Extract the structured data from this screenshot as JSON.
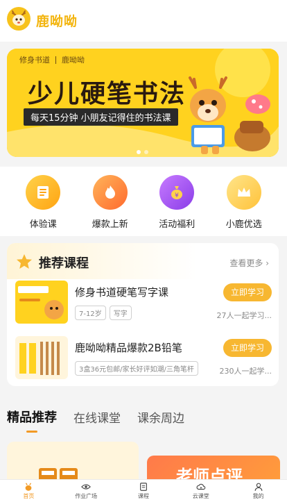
{
  "app": {
    "name": "鹿呦呦"
  },
  "banner": {
    "brand_left": "修身书道",
    "brand_right": "鹿呦呦",
    "title": "少儿硬笔书法",
    "subtitle": "每天15分钟 小朋友记得住的书法课",
    "slides": 2,
    "active_slide": 0
  },
  "quicknav": [
    {
      "label": "体验课",
      "icon": "book-icon",
      "color": "#ffb20f"
    },
    {
      "label": "爆款上新",
      "icon": "flame-icon",
      "color": "#ff8a3d"
    },
    {
      "label": "活动福利",
      "icon": "money-bag-icon",
      "color": "#a84df0"
    },
    {
      "label": "小鹿优选",
      "icon": "crown-icon",
      "color": "#ffc94a"
    }
  ],
  "recommended": {
    "title": "推荐课程",
    "more": "查看更多",
    "courses": [
      {
        "title": "修身书道硬笔写字课",
        "tags": [
          "7-12岁",
          "写字"
        ],
        "button": "立即学习",
        "learners": "27人一起学习..."
      },
      {
        "title": "鹿呦呦精品爆款2B铅笔",
        "tags": [
          "3盒36元包邮/家长好评如潮/三角笔杆"
        ],
        "button": "立即学习",
        "learners": "230人一起学..."
      }
    ]
  },
  "tabs": [
    "精品推荐",
    "在线课堂",
    "课余周边"
  ],
  "active_tab": 0,
  "feed": {
    "card_text": "老师点评"
  },
  "bottom_nav": [
    {
      "label": "首页",
      "icon": "home-deer-icon"
    },
    {
      "label": "作业广场",
      "icon": "eye-icon"
    },
    {
      "label": "课程",
      "icon": "course-icon"
    },
    {
      "label": "云课堂",
      "icon": "cloud-play-icon"
    },
    {
      "label": "我的",
      "icon": "user-icon"
    }
  ],
  "colors": {
    "accent": "#f7b731",
    "tab_indicator": "#f29a25",
    "banner_bg": "#ffd21f"
  }
}
